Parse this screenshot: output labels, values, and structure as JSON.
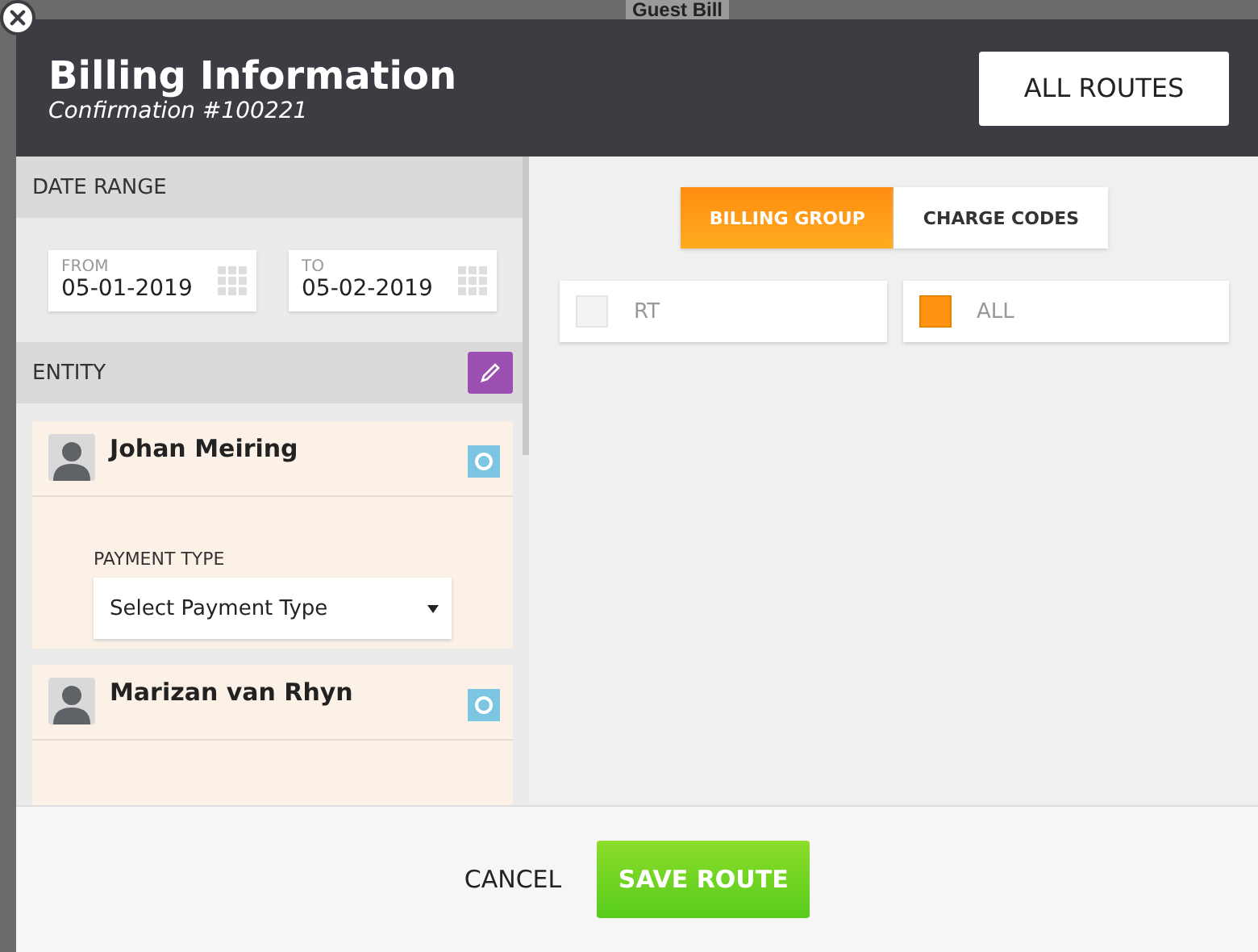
{
  "background": {
    "heading": "Guest Bill"
  },
  "dialog": {
    "title": "Billing Information",
    "subtitle": "Confirmation #100221",
    "action": "ALL ROUTES"
  },
  "date_range": {
    "heading": "DATE RANGE",
    "fields": [
      {
        "label": "FROM",
        "value": "05-01-2019"
      },
      {
        "label": "TO",
        "value": "05-02-2019"
      }
    ]
  },
  "entity": {
    "heading": "ENTITY",
    "items": [
      {
        "name": "Johan Meiring",
        "payment_label": "PAYMENT TYPE",
        "payment_value": "Select Payment Type"
      },
      {
        "name": "Marizan van Rhyn"
      }
    ]
  },
  "tabs": [
    {
      "label": "BILLING GROUP",
      "selected": true
    },
    {
      "label": "CHARGE CODES",
      "selected": false
    }
  ],
  "options": [
    {
      "label": "RT",
      "checked": false
    },
    {
      "label": "ALL",
      "checked": true
    }
  ],
  "footer": {
    "cancel": "CANCEL",
    "save": "SAVE ROUTE"
  }
}
